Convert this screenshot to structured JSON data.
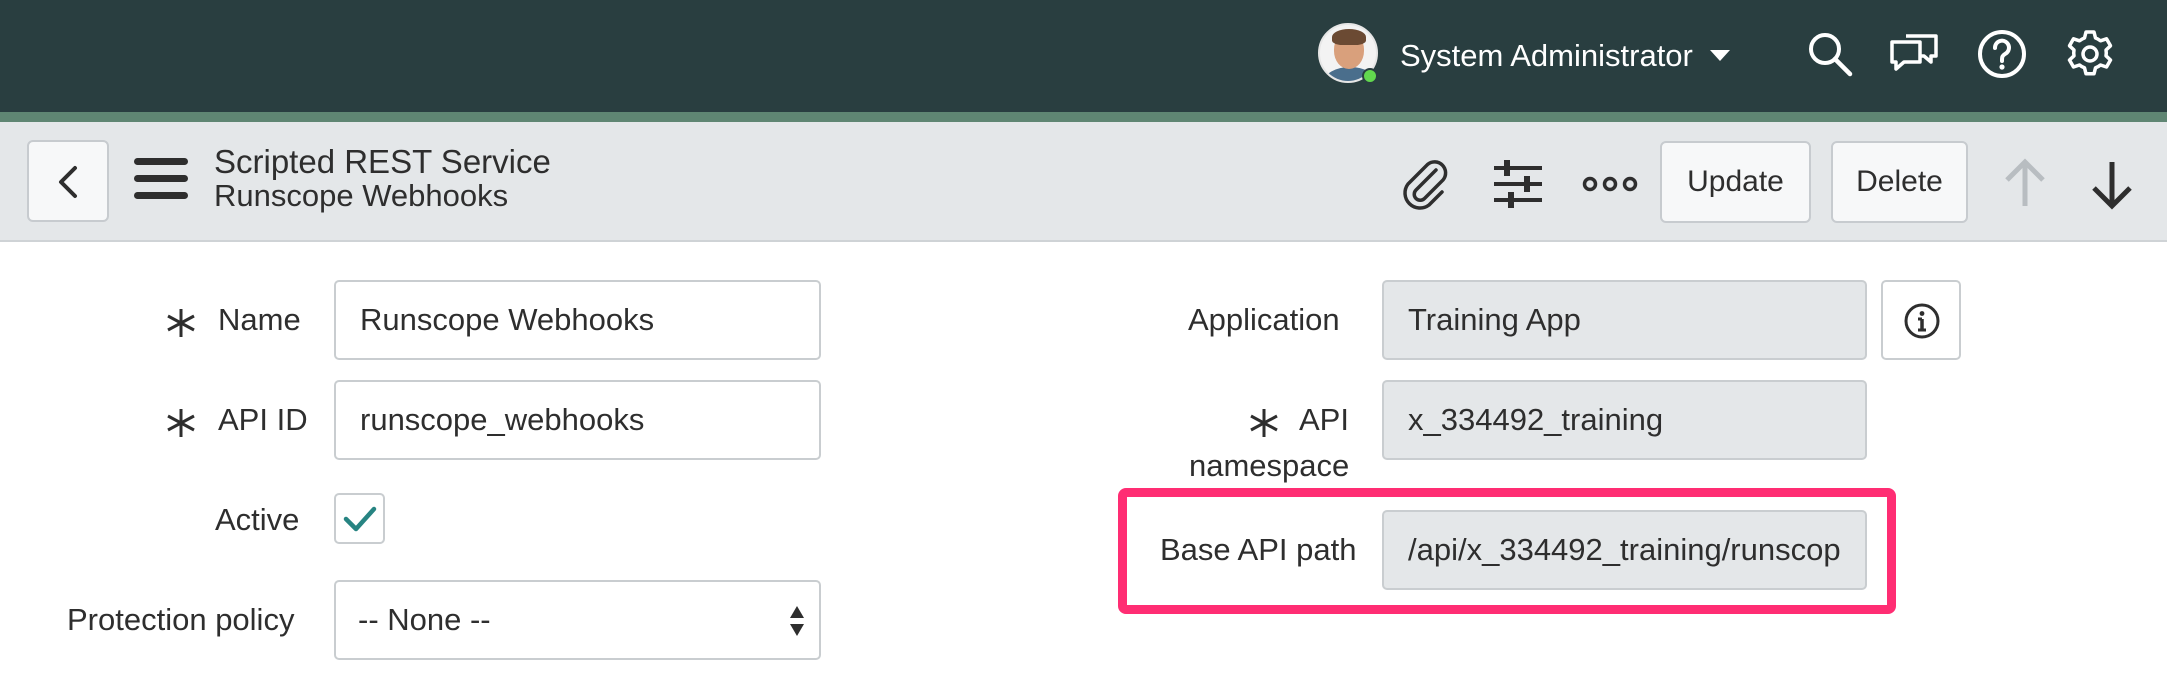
{
  "header": {
    "user_name": "System Administrator",
    "icons": [
      "search-icon",
      "chat-icon",
      "help-icon",
      "gear-icon"
    ],
    "colors": {
      "banner": "#293e40",
      "stripe": "#5f8673",
      "presence": "#62d84e"
    }
  },
  "form_header": {
    "record_type": "Scripted REST Service",
    "record_name": "Runscope Webhooks",
    "update_label": "Update",
    "delete_label": "Delete",
    "icons": [
      "back-icon",
      "menu-icon",
      "attachment-icon",
      "personalize-icon",
      "more-icon",
      "previous-record-icon",
      "next-record-icon"
    ]
  },
  "form": {
    "name": {
      "label": "Name",
      "value": "Runscope Webhooks",
      "required": true
    },
    "api_id": {
      "label": "API ID",
      "value": "runscope_webhooks",
      "required": true
    },
    "active": {
      "label": "Active",
      "checked": true
    },
    "protection_policy": {
      "label": "Protection policy",
      "selected": "-- None --"
    },
    "application": {
      "label": "Application",
      "value": "Training App"
    },
    "api_namespace": {
      "label_line1": "API",
      "label_line2": "namespace",
      "value": "x_334492_training",
      "required": true
    },
    "base_api_path": {
      "label": "Base API path",
      "value": "/api/x_334492_training/runscop"
    }
  },
  "highlight_color": "#ff2d73"
}
